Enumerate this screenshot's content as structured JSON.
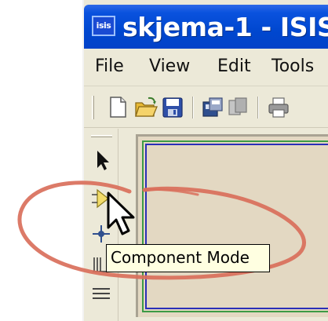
{
  "window": {
    "app_icon_text": "isis",
    "title": "skjema-1 - ISIS"
  },
  "menu": {
    "items": [
      "File",
      "View",
      "Edit",
      "Tools"
    ]
  },
  "toolbar": {
    "icons": [
      "new-document-icon",
      "open-folder-icon",
      "save-disk-icon",
      "import-icon",
      "copy-icon",
      "print-icon"
    ]
  },
  "mode_toolbar": {
    "icons": [
      "selection-arrow-icon",
      "component-mode-icon",
      "junction-dot-icon",
      "wire-label-icon",
      "text-script-icon"
    ],
    "active": "Component Mode"
  },
  "tooltip": {
    "text": "Component Mode"
  },
  "annotation": {
    "highlight_color": "#d96f5b"
  },
  "colors": {
    "titlebar": "#0047cf",
    "window_bg": "#ece9d8",
    "canvas_bg": "#e3d8c2",
    "frame_blue": "#2a2fb8",
    "frame_green": "#3c9b45",
    "tooltip_bg": "#ffffe1"
  }
}
